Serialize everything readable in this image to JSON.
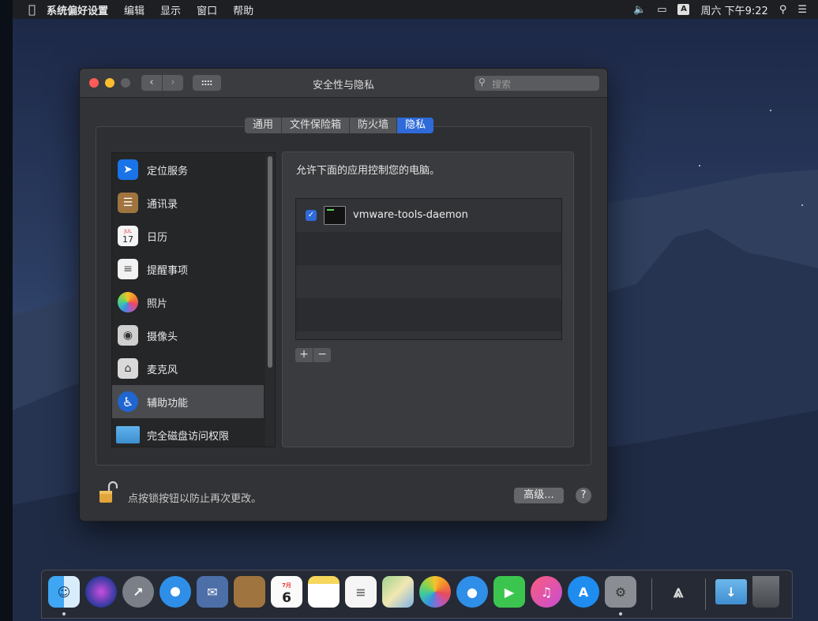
{
  "menubar": {
    "apple": "",
    "app_name": "系统偏好设置",
    "menus": [
      "编辑",
      "显示",
      "窗口",
      "帮助"
    ],
    "input_badge": "A",
    "clock": "周六 下午9:22"
  },
  "window": {
    "title": "安全性与隐私",
    "search_placeholder": "搜索",
    "tabs": [
      {
        "label": "通用",
        "active": false
      },
      {
        "label": "文件保险箱",
        "active": false
      },
      {
        "label": "防火墙",
        "active": false
      },
      {
        "label": "隐私",
        "active": true
      }
    ],
    "sidebar": [
      {
        "label": "定位服务",
        "icon": "location-arrow-icon",
        "selected": false
      },
      {
        "label": "通讯录",
        "icon": "contacts-book-icon",
        "selected": false
      },
      {
        "label": "日历",
        "icon": "calendar-icon",
        "selected": false
      },
      {
        "label": "提醒事项",
        "icon": "reminders-icon",
        "selected": false
      },
      {
        "label": "照片",
        "icon": "photos-icon",
        "selected": false
      },
      {
        "label": "摄像头",
        "icon": "camera-icon",
        "selected": false
      },
      {
        "label": "麦克风",
        "icon": "microphone-icon",
        "selected": false
      },
      {
        "label": "辅助功能",
        "icon": "accessibility-icon",
        "selected": true
      },
      {
        "label": "完全磁盘访问权限",
        "icon": "folder-icon",
        "selected": false
      }
    ],
    "calendar_month": "JUL",
    "calendar_day": "17",
    "pane": {
      "description": "允许下面的应用控制您的电脑。",
      "apps": [
        {
          "name": "vmware-tools-daemon",
          "checked": true
        }
      ],
      "add_label": "+",
      "remove_label": "−"
    },
    "lock_text": "点按锁按钮以防止再次更改。",
    "advanced_label": "高级...",
    "help_label": "?"
  },
  "dock": {
    "calendar_month": "7月",
    "calendar_day": "6"
  }
}
